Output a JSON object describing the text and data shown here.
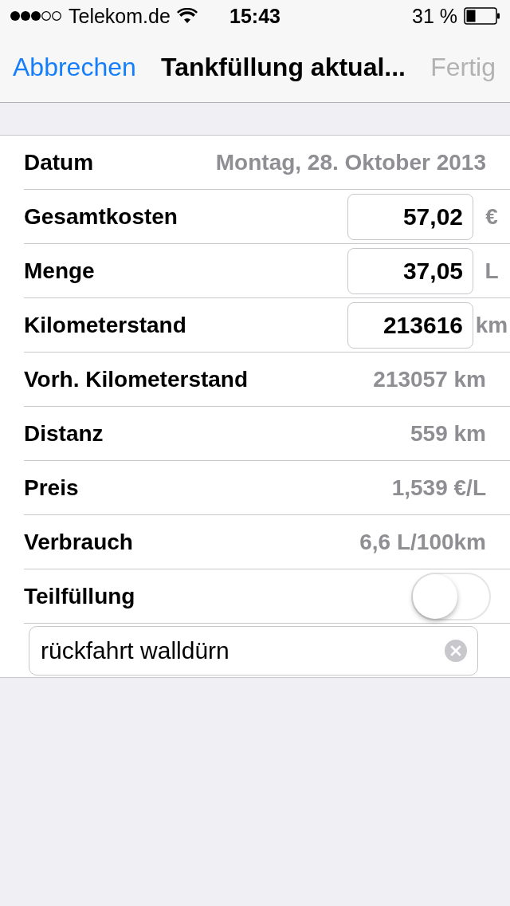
{
  "status_bar": {
    "carrier": "Telekom.de",
    "time": "15:43",
    "battery": "31 %"
  },
  "nav": {
    "left": "Abbrechen",
    "title": "Tankfüllung aktual...",
    "right": {
      "label": "Fertig",
      "disabled": true
    }
  },
  "rows": [
    {
      "kind": "text",
      "label": "Datum",
      "value": "Montag, 28. Oktober 2013"
    },
    {
      "kind": "input",
      "label": "Gesamtkosten",
      "value": "57,02",
      "unit": "€"
    },
    {
      "kind": "input",
      "label": "Menge",
      "value": "37,05",
      "unit": "L"
    },
    {
      "kind": "input",
      "label": "Kilometerstand",
      "value": "213616",
      "unit": "km"
    },
    {
      "kind": "text",
      "label": "Vorh. Kilometerstand",
      "value": "213057 km"
    },
    {
      "kind": "text",
      "label": "Distanz",
      "value": "559 km"
    },
    {
      "kind": "text",
      "label": "Preis",
      "value": "1,539 €/L"
    },
    {
      "kind": "text",
      "label": "Verbrauch",
      "value": "6,6 L/100km"
    },
    {
      "kind": "toggle",
      "label": "Teilfüllung",
      "on": false
    }
  ],
  "note": {
    "value": "rückfahrt walldürn"
  }
}
